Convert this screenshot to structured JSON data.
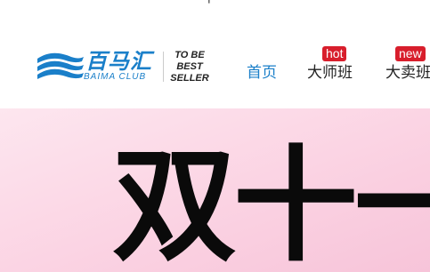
{
  "top_glyph": "年",
  "logo": {
    "cn": "百马汇",
    "en": "BAIMA CLUB",
    "slogan_lines": [
      "TO BE",
      "BEST",
      "SELLER"
    ]
  },
  "nav": {
    "items": [
      {
        "label": "首页",
        "active": true
      },
      {
        "label": "大师班",
        "badge": "hot"
      },
      {
        "label": "大卖班",
        "badge": "new"
      }
    ]
  },
  "banner": {
    "title": "双十一"
  },
  "colors": {
    "brand_blue": "#1a7fc9",
    "badge_red": "#d81e2c",
    "banner_pink": "#fbd3e3"
  }
}
